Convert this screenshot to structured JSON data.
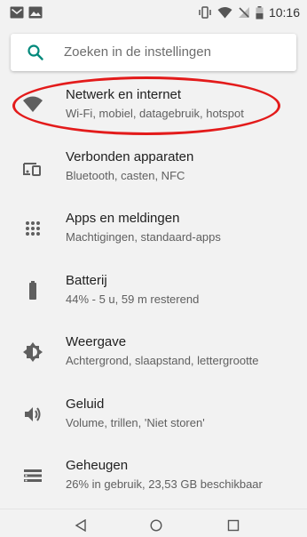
{
  "status_bar": {
    "time": "10:16",
    "left_icons": [
      "gmail-icon",
      "image-icon"
    ],
    "right_icons": [
      "vibrate-icon",
      "wifi-icon",
      "no-signal-icon",
      "battery-icon"
    ]
  },
  "search": {
    "placeholder": "Zoeken in de instellingen"
  },
  "settings": [
    {
      "title": "Netwerk en internet",
      "subtitle": "Wi-Fi, mobiel, datagebruik, hotspot",
      "icon": "wifi-icon"
    },
    {
      "title": "Verbonden apparaten",
      "subtitle": "Bluetooth, casten, NFC",
      "icon": "devices-icon"
    },
    {
      "title": "Apps en meldingen",
      "subtitle": "Machtigingen, standaard-apps",
      "icon": "apps-grid-icon"
    },
    {
      "title": "Batterij",
      "subtitle": "44% - 5 u, 59 m resterend",
      "icon": "battery-icon"
    },
    {
      "title": "Weergave",
      "subtitle": "Achtergrond, slaapstand, lettergrootte",
      "icon": "brightness-icon"
    },
    {
      "title": "Geluid",
      "subtitle": "Volume, trillen, 'Niet storen'",
      "icon": "volume-icon"
    },
    {
      "title": "Geheugen",
      "subtitle": "26% in gebruik, 23,53 GB beschikbaar",
      "icon": "storage-icon"
    }
  ],
  "colors": {
    "accent": "#00897b",
    "highlight": "#e31b1b",
    "icon": "#5f5f5f",
    "background": "#f2f2f2"
  },
  "nav_bar": {
    "buttons": [
      "back-icon",
      "home-icon",
      "recents-icon"
    ]
  }
}
